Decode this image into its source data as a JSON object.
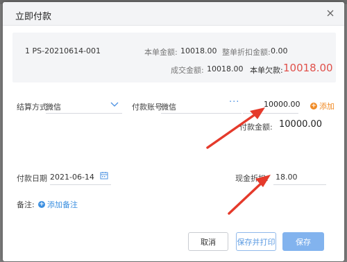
{
  "dialog": {
    "title": "立即付款"
  },
  "summary": {
    "order_no": "1 PS-20210614-001",
    "amount_label": "本单金额:",
    "amount_value": "10018.00",
    "discount_label": "整单折扣金额:",
    "discount_value": "0.00",
    "deal_label": "成交金额:",
    "deal_value": "10018.00",
    "due_label": "本单欠款:",
    "due_value": "10018.00"
  },
  "form": {
    "settle_label": "结算方式",
    "settle_value": "微信",
    "account_label": "付款账号",
    "account_value": "微信",
    "pay_amount_input": "10000.00",
    "add_label": "添加",
    "pay_total_label": "付款金额:",
    "pay_total_value": "10000.00",
    "date_label": "付款日期",
    "date_value": "2021-06-14",
    "cash_discount_label": "现金折扣:",
    "cash_discount_value": "18.00",
    "remark_label": "备注:",
    "add_remark_label": "添加备注"
  },
  "buttons": {
    "cancel": "取消",
    "save_print": "保存并打印",
    "save": "保存"
  },
  "colors": {
    "accent": "#3b8fe0",
    "due": "#e0504a",
    "add_orange": "#f08a24",
    "arrow": "#e53a2b"
  },
  "icons": {
    "close": "close-icon",
    "dropdown": "chevron-down-icon",
    "more": "more-dots-icon",
    "add": "plus-circle-icon",
    "calendar": "calendar-icon"
  }
}
